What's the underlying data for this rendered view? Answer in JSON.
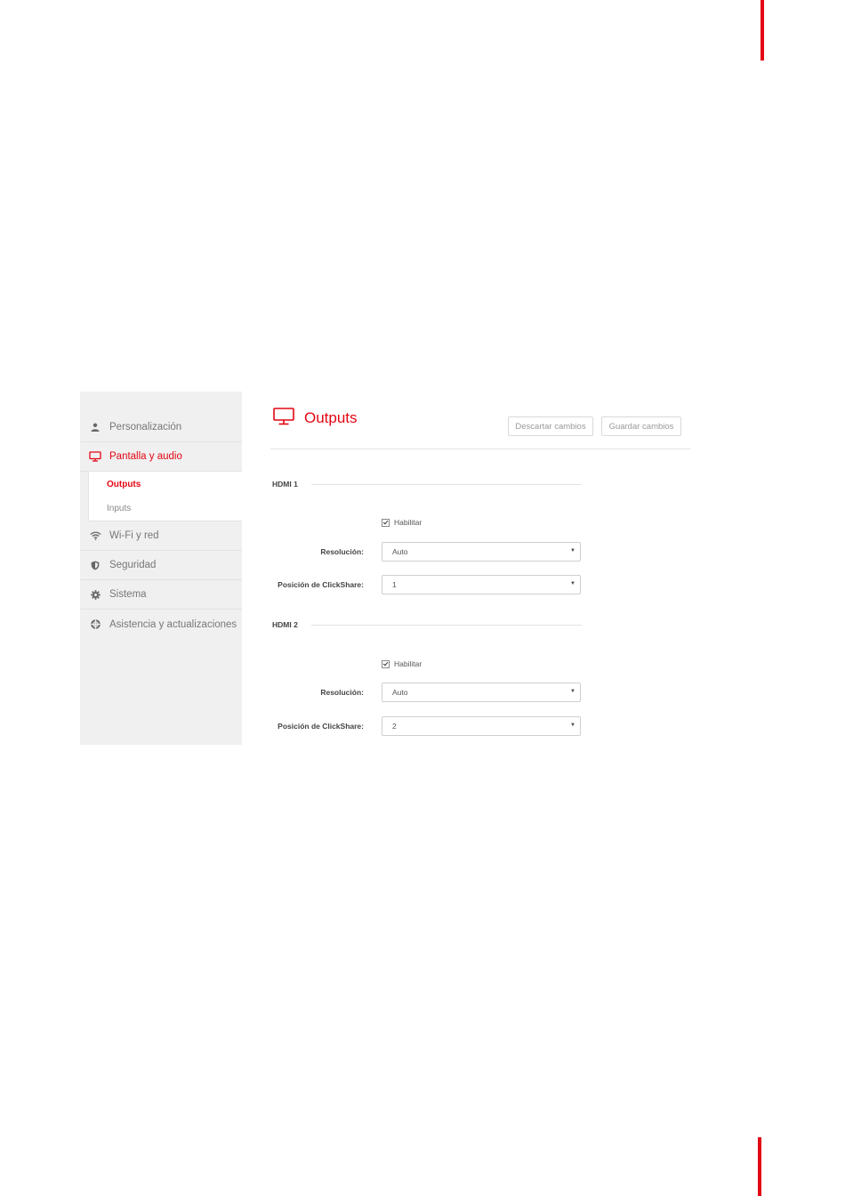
{
  "sidebar": {
    "items": [
      {
        "label": "Personalización",
        "icon": "user-icon"
      },
      {
        "label": "Pantalla y audio",
        "icon": "monitor-icon"
      },
      {
        "label": "Wi-Fi y red",
        "icon": "wifi-icon"
      },
      {
        "label": "Seguridad",
        "icon": "shield-icon"
      },
      {
        "label": "Sistema",
        "icon": "gear-icon"
      },
      {
        "label": "Asistencia y actualizaciones",
        "icon": "lifebuoy-icon"
      }
    ],
    "subitems": [
      {
        "label": "Outputs"
      },
      {
        "label": "Inputs"
      }
    ]
  },
  "main": {
    "title": "Outputs",
    "buttons": {
      "discard_label": "Descartar cambios",
      "save_label": "Guardar cambios"
    },
    "sections": [
      {
        "title": "HDMI 1",
        "enable_label": "Habilitar",
        "enabled": true,
        "resolution_label": "Resolución:",
        "resolution_value": "Auto",
        "position_label": "Posición de ClickShare:",
        "position_value": "1"
      },
      {
        "title": "HDMI 2",
        "enable_label": "Habilitar",
        "enabled": true,
        "resolution_label": "Resolución:",
        "resolution_value": "Auto",
        "position_label": "Posición de ClickShare:",
        "position_value": "2"
      }
    ]
  },
  "colors": {
    "accent": "#e30613",
    "sidebar_bg": "#f0f0f0"
  }
}
